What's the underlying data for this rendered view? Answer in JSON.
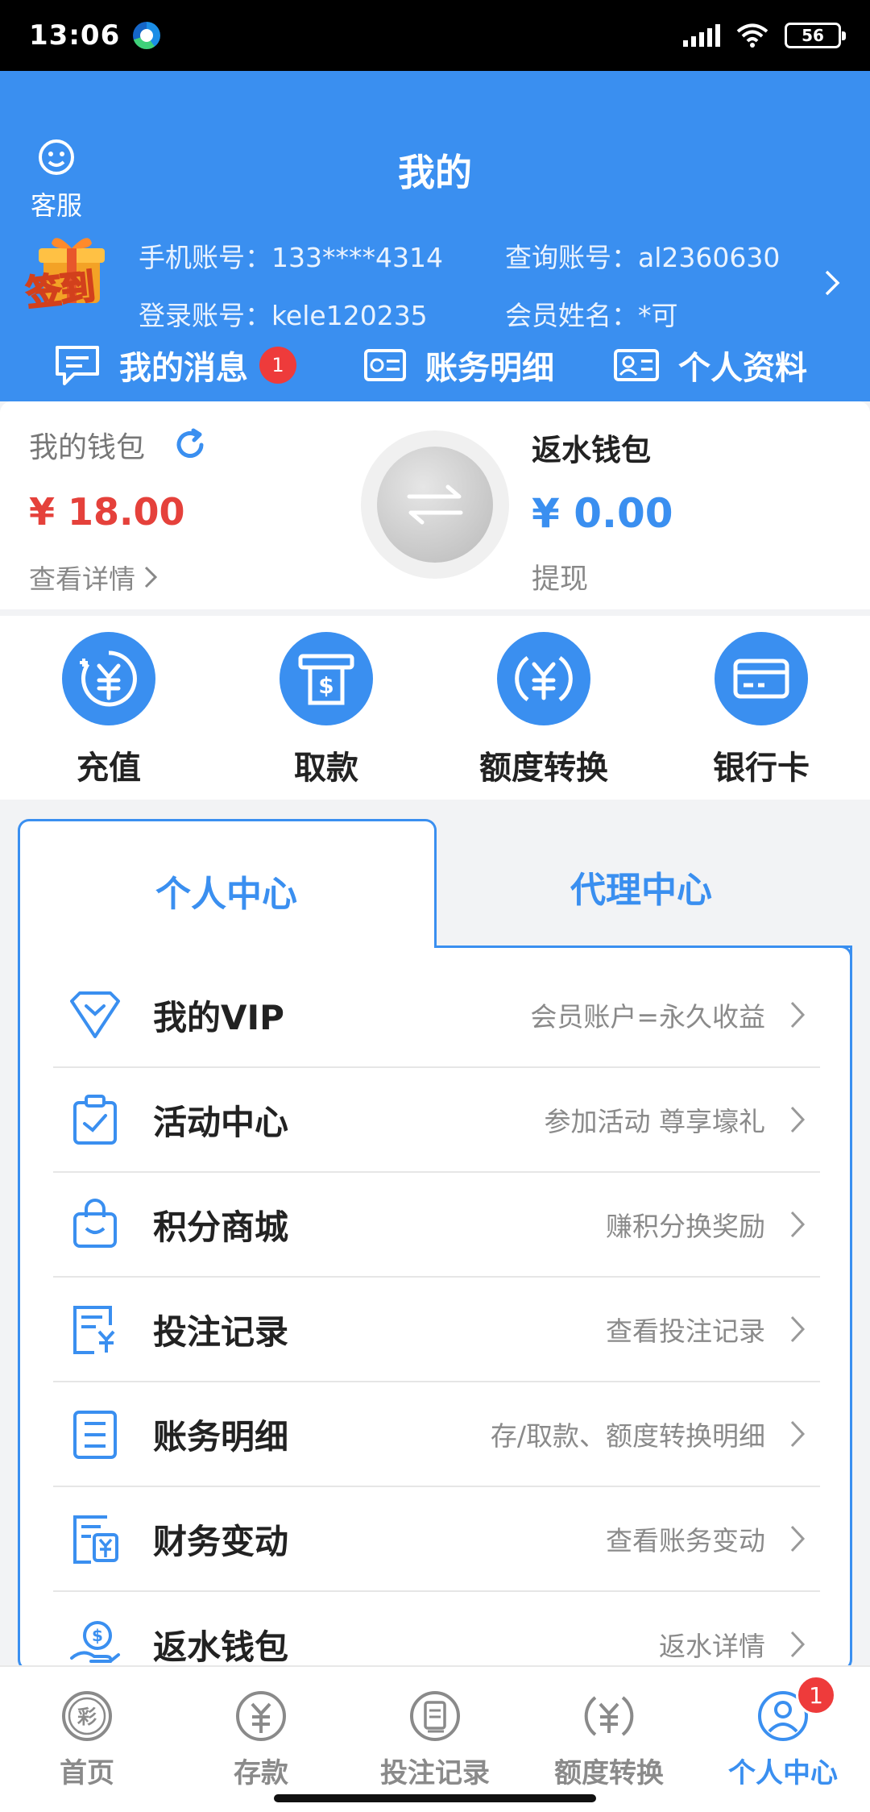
{
  "status_bar": {
    "time": "13:06",
    "battery": "56"
  },
  "header": {
    "title": "我的",
    "customer_service": "客服",
    "checkin": "签到",
    "account": {
      "phone_label": "手机账号：",
      "phone_value": "133****4314",
      "query_label": "查询账号：",
      "query_value": "al2360630",
      "login_label": "登录账号：",
      "login_value": "kele120235",
      "name_label": "会员姓名：",
      "name_value": "*可"
    },
    "quick_links": {
      "messages": "我的消息",
      "messages_badge": "1",
      "ledger": "账务明细",
      "profile": "个人资料"
    }
  },
  "wallet": {
    "my_wallet_label": "我的钱包",
    "my_wallet_amount": "¥ 18.00",
    "view_details": "查看详情",
    "rebate_wallet_label": "返水钱包",
    "rebate_amount": "¥ 0.00",
    "withdraw": "提现"
  },
  "actions": [
    {
      "label": "充值",
      "icon": "recharge-icon"
    },
    {
      "label": "取款",
      "icon": "atm-withdraw-icon"
    },
    {
      "label": "额度转换",
      "icon": "yuan-exchange-icon"
    },
    {
      "label": "银行卡",
      "icon": "bank-card-icon"
    }
  ],
  "tabs": {
    "personal": "个人中心",
    "agent": "代理中心"
  },
  "menu": [
    {
      "title": "我的VIP",
      "desc": "会员账户=永久收益",
      "icon": "vip-diamond-icon"
    },
    {
      "title": "活动中心",
      "desc": "参加活动 尊享壕礼",
      "icon": "clipboard-check-icon"
    },
    {
      "title": "积分商城",
      "desc": "赚积分换奖励",
      "icon": "shopping-bag-icon"
    },
    {
      "title": "投注记录",
      "desc": "查看投注记录",
      "icon": "bet-record-icon"
    },
    {
      "title": "账务明细",
      "desc": "存/取款、额度转换明细",
      "icon": "ledger-list-icon"
    },
    {
      "title": "财务变动",
      "desc": "查看账务变动",
      "icon": "finance-change-icon"
    },
    {
      "title": "返水钱包",
      "desc": "返水详情",
      "icon": "rebate-hand-icon"
    }
  ],
  "bottom_nav": [
    {
      "label": "首页",
      "icon": "lottery-home-icon"
    },
    {
      "label": "存款",
      "icon": "deposit-yuan-icon"
    },
    {
      "label": "投注记录",
      "icon": "bet-record-nav-icon"
    },
    {
      "label": "额度转换",
      "icon": "exchange-nav-icon"
    },
    {
      "label": "个人中心",
      "icon": "user-nav-icon",
      "badge": "1",
      "active": true
    }
  ],
  "colors": {
    "primary": "#3a8ff0",
    "amount_red": "#e5413b",
    "badge_red": "#ee3b3b"
  }
}
